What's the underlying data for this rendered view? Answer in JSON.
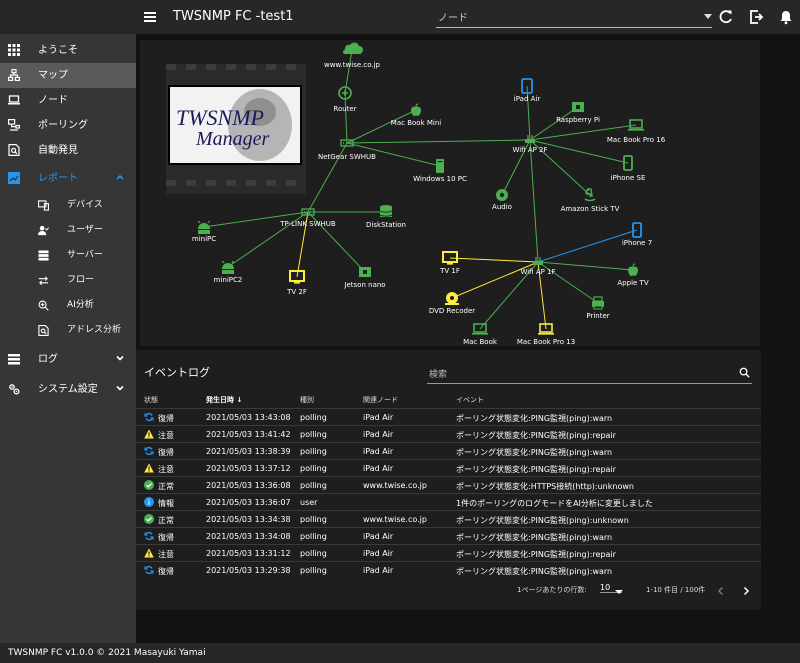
{
  "app": {
    "title": "TWSNMP FC -test1"
  },
  "header": {
    "node_placeholder": "ノード"
  },
  "sidebar": {
    "items": [
      {
        "label": "ようこそ"
      },
      {
        "label": "マップ"
      },
      {
        "label": "ノード"
      },
      {
        "label": "ポーリング"
      },
      {
        "label": "自動発見"
      },
      {
        "label": "レポート"
      },
      {
        "label": "ログ"
      },
      {
        "label": "システム設定"
      }
    ],
    "report_sub": [
      {
        "label": "デバイス"
      },
      {
        "label": "ユーザー"
      },
      {
        "label": "サーバー"
      },
      {
        "label": "フロー"
      },
      {
        "label": "AI分析"
      },
      {
        "label": "アドレス分析"
      }
    ]
  },
  "map": {
    "logo_line1": "TWSNMP",
    "logo_line2": "Manager",
    "nodes": [
      {
        "label": "www.twise.co.jp",
        "icon": "cloud",
        "color": "#4caf50"
      },
      {
        "label": "Router",
        "icon": "router",
        "color": "#4caf50"
      },
      {
        "label": "Mac Book Mini",
        "icon": "apple",
        "color": "#4caf50"
      },
      {
        "label": "NetGear SWHUB",
        "icon": "hub",
        "color": "#4caf50"
      },
      {
        "label": "Windows 10 PC",
        "icon": "desktop",
        "color": "#4caf50"
      },
      {
        "label": "iPad Air",
        "icon": "tablet",
        "color": "#2196f3"
      },
      {
        "label": "Raspberry Pi",
        "icon": "board",
        "color": "#4caf50"
      },
      {
        "label": "Mac Book Pro 16",
        "icon": "laptop",
        "color": "#4caf50"
      },
      {
        "label": "Wifi AP 2F",
        "icon": "wifi",
        "color": "#4caf50"
      },
      {
        "label": "iPhone SE",
        "icon": "phone",
        "color": "#4caf50"
      },
      {
        "label": "Audio",
        "icon": "speaker",
        "color": "#4caf50"
      },
      {
        "label": "Amazon  Stick TV",
        "icon": "amazon",
        "color": "#4caf50"
      },
      {
        "label": "DiskStation",
        "icon": "disk",
        "color": "#4caf50"
      },
      {
        "label": "TP-LINK SWHUB",
        "icon": "hub",
        "color": "#4caf50"
      },
      {
        "label": "miniPC",
        "icon": "android",
        "color": "#4caf50"
      },
      {
        "label": "miniPC2",
        "icon": "android",
        "color": "#4caf50"
      },
      {
        "label": "TV 2F",
        "icon": "tv",
        "color": "#ffeb3b"
      },
      {
        "label": "Jetson nano",
        "icon": "board",
        "color": "#4caf50"
      },
      {
        "label": "iPhone 7",
        "icon": "phone",
        "color": "#2196f3"
      },
      {
        "label": "TV 1F",
        "icon": "tv",
        "color": "#ffeb3b"
      },
      {
        "label": "Wifi AP 1F",
        "icon": "wifi",
        "color": "#4caf50"
      },
      {
        "label": "Apple TV",
        "icon": "apple",
        "color": "#4caf50"
      },
      {
        "label": "DVD Recoder",
        "icon": "disc",
        "color": "#ffeb3b"
      },
      {
        "label": "Printer",
        "icon": "printer",
        "color": "#4caf50"
      },
      {
        "label": "Mac Book",
        "icon": "laptop",
        "color": "#4caf50"
      },
      {
        "label": "Mac Book Pro 13",
        "icon": "laptop",
        "color": "#ffeb3b"
      }
    ],
    "edges": [
      {
        "from": 0,
        "to": 1,
        "color": "#4caf50"
      },
      {
        "from": 1,
        "to": 3,
        "color": "#4caf50"
      },
      {
        "from": 2,
        "to": 3,
        "color": "#4caf50"
      },
      {
        "from": 3,
        "to": 4,
        "color": "#4caf50"
      },
      {
        "from": 3,
        "to": 8,
        "color": "#4caf50"
      },
      {
        "from": 3,
        "to": 13,
        "color": "#4caf50"
      },
      {
        "from": 5,
        "to": 8,
        "color": "#4caf50"
      },
      {
        "from": 6,
        "to": 8,
        "color": "#4caf50"
      },
      {
        "from": 7,
        "to": 8,
        "color": "#4caf50"
      },
      {
        "from": 9,
        "to": 8,
        "color": "#4caf50"
      },
      {
        "from": 10,
        "to": 8,
        "color": "#4caf50"
      },
      {
        "from": 11,
        "to": 8,
        "color": "#4caf50"
      },
      {
        "from": 8,
        "to": 20,
        "color": "#4caf50"
      },
      {
        "from": 13,
        "to": 12,
        "color": "#4caf50"
      },
      {
        "from": 13,
        "to": 14,
        "color": "#4caf50"
      },
      {
        "from": 13,
        "to": 15,
        "color": "#4caf50"
      },
      {
        "from": 13,
        "to": 16,
        "color": "#ffeb3b"
      },
      {
        "from": 13,
        "to": 17,
        "color": "#4caf50"
      },
      {
        "from": 18,
        "to": 20,
        "color": "#2196f3"
      },
      {
        "from": 19,
        "to": 20,
        "color": "#ffeb3b"
      },
      {
        "from": 21,
        "to": 20,
        "color": "#4caf50"
      },
      {
        "from": 22,
        "to": 20,
        "color": "#ffeb3b"
      },
      {
        "from": 23,
        "to": 20,
        "color": "#4caf50"
      },
      {
        "from": 24,
        "to": 20,
        "color": "#4caf50"
      },
      {
        "from": 25,
        "to": 20,
        "color": "#ffeb3b"
      }
    ]
  },
  "events": {
    "title": "イベントログ",
    "search_placeholder": "検索",
    "columns": [
      "状態",
      "発生日時",
      "種別",
      "関連ノード",
      "イベント"
    ],
    "rows": [
      {
        "state": "復帰",
        "icon": "repair",
        "time": "2021/05/03 13:43:08",
        "type": "polling",
        "node": "iPad Air",
        "event": "ポーリング状態変化:PING監視(ping):warn"
      },
      {
        "state": "注意",
        "icon": "warn",
        "time": "2021/05/03 13:41:42",
        "type": "polling",
        "node": "iPad Air",
        "event": "ポーリング状態変化:PING監視(ping):repair"
      },
      {
        "state": "復帰",
        "icon": "repair",
        "time": "2021/05/03 13:38:39",
        "type": "polling",
        "node": "iPad Air",
        "event": "ポーリング状態変化:PING監視(ping):warn"
      },
      {
        "state": "注意",
        "icon": "warn",
        "time": "2021/05/03 13:37:12",
        "type": "polling",
        "node": "iPad Air",
        "event": "ポーリング状態変化:PING監視(ping):repair"
      },
      {
        "state": "正常",
        "icon": "normal",
        "time": "2021/05/03 13:36:08",
        "type": "polling",
        "node": "www.twise.co.jp",
        "event": "ポーリング状態変化:HTTPS接続(http):unknown"
      },
      {
        "state": "情報",
        "icon": "info",
        "time": "2021/05/03 13:36:07",
        "type": "user",
        "node": "",
        "event": "1件のポーリングのログモードをAI分析に変更しました"
      },
      {
        "state": "正常",
        "icon": "normal",
        "time": "2021/05/03 13:34:38",
        "type": "polling",
        "node": "www.twise.co.jp",
        "event": "ポーリング状態変化:PING監視(ping):unknown"
      },
      {
        "state": "復帰",
        "icon": "repair",
        "time": "2021/05/03 13:34:08",
        "type": "polling",
        "node": "iPad Air",
        "event": "ポーリング状態変化:PING監視(ping):warn"
      },
      {
        "state": "注意",
        "icon": "warn",
        "time": "2021/05/03 13:31:12",
        "type": "polling",
        "node": "iPad Air",
        "event": "ポーリング状態変化:PING監視(ping):repair"
      },
      {
        "state": "復帰",
        "icon": "repair",
        "time": "2021/05/03 13:29:38",
        "type": "polling",
        "node": "iPad Air",
        "event": "ポーリング状態変化:PING監視(ping):warn"
      }
    ],
    "rows_per_page_label": "1ページあたりの行数:",
    "rows_per_page": "10",
    "range": "1-10 件目 / 100件"
  },
  "footer": {
    "text": "TWSNMP FC v1.0.0 © 2021 Masayuki Yamai"
  },
  "colors": {
    "accent": "#2196f3",
    "normal": "#4caf50",
    "warn": "#ffeb3b",
    "repair": "#2196f3",
    "info": "#2196f3"
  }
}
